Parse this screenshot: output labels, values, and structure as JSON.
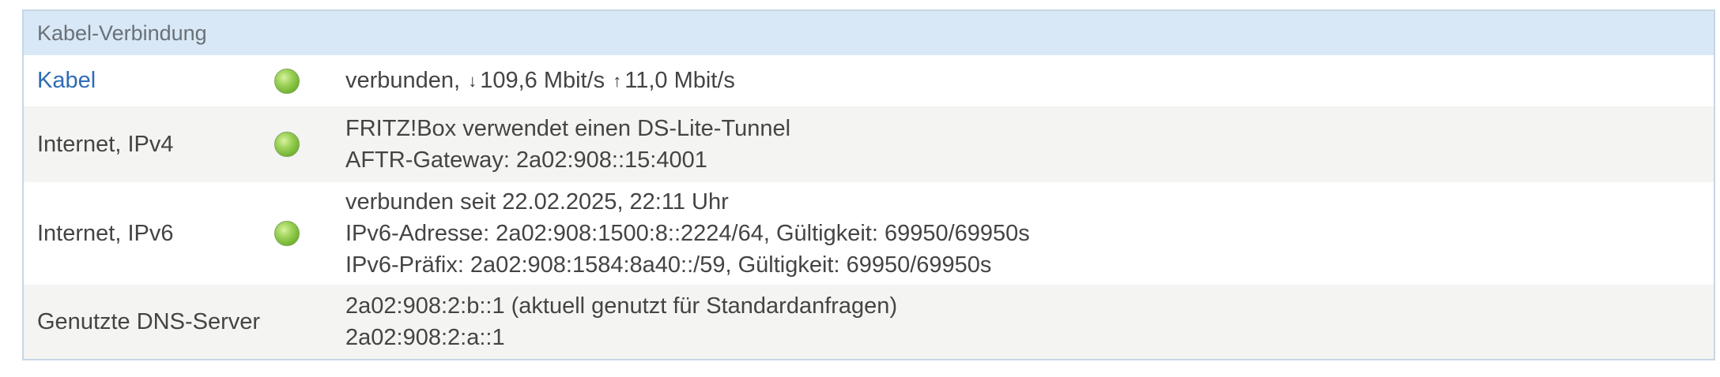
{
  "panel": {
    "title": "Kabel-Verbindung"
  },
  "rows": [
    {
      "label": "Kabel",
      "status": "connected",
      "value_prefix": "verbunden,",
      "down_arrow": "↓",
      "down_rate": "109,6 Mbit/s",
      "up_arrow": "↑",
      "up_rate": "11,0 Mbit/s"
    },
    {
      "label": "Internet, IPv4",
      "status": "connected",
      "lines": [
        "FRITZ!Box verwendet einen DS-Lite-Tunnel",
        "AFTR-Gateway: 2a02:908::15:4001"
      ]
    },
    {
      "label": "Internet, IPv6",
      "status": "connected",
      "lines": [
        "verbunden seit 22.02.2025, 22:11 Uhr",
        "IPv6-Adresse: 2a02:908:1500:8::2224/64, Gültigkeit: 69950/69950s",
        "IPv6-Präfix: 2a02:908:1584:8a40::/59, Gültigkeit: 69950/69950s"
      ]
    },
    {
      "label": "Genutzte DNS-Server",
      "lines": [
        "2a02:908:2:b::1 (aktuell genutzt für Standardanfragen)",
        "2a02:908:2:a::1"
      ]
    }
  ],
  "colors": {
    "header_bg": "#d9e8f6",
    "link": "#2f6bb6",
    "led_green": "#8cc84b",
    "alt_row_bg": "#f4f4f2"
  }
}
